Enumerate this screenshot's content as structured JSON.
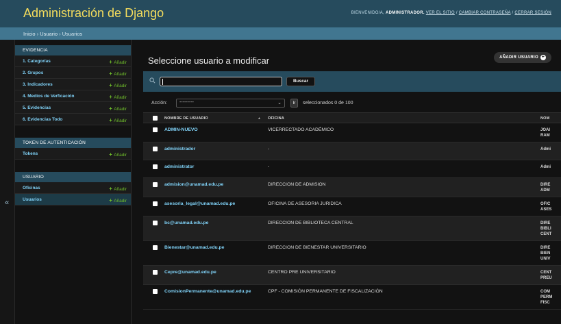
{
  "header": {
    "site_name": "Administración de Django",
    "welcome": "BIENVENIDO/A,",
    "username": "ADMINISTRADOR.",
    "view_site": "VER EL SITIO",
    "change_password": "CAMBIAR CONTRASEÑA",
    "logout": "CERRAR SESIÓN",
    "separator": " / "
  },
  "breadcrumbs": {
    "items": [
      "Inicio",
      "Usuario",
      "Usuarios"
    ],
    "separator": " › "
  },
  "nav_toggle": "«",
  "sidebar": {
    "add_label": "Añadir",
    "modules": [
      {
        "caption": "EVIDENCIA",
        "models": [
          {
            "name": "1. Categorías",
            "add": true
          },
          {
            "name": "2. Grupos",
            "add": true
          },
          {
            "name": "3. Indicadores",
            "add": true
          },
          {
            "name": "4. Medios de Verficación",
            "add": true
          },
          {
            "name": "5. Evidencias",
            "add": true
          },
          {
            "name": "6. Evidencias Todo",
            "add": true
          }
        ]
      },
      {
        "caption": "TOKEN DE AUTENTICACIÓN",
        "models": [
          {
            "name": "Tokens",
            "add": true
          }
        ]
      },
      {
        "caption": "USUARIO",
        "models": [
          {
            "name": "Oficinas",
            "add": true
          },
          {
            "name": "Usuarios",
            "add": true,
            "current": true
          }
        ]
      }
    ]
  },
  "content": {
    "title": "Seleccione usuario a modificar",
    "add_button": "AÑADIR USUARIO",
    "search_value": "",
    "search_button": "Buscar",
    "action_label": "Acción:",
    "action_selected": "---------",
    "go_button": "Ir",
    "counter": "seleccionados 0 de 100"
  },
  "table": {
    "columns": [
      "NOMBRE DE USUARIO",
      "OFICINA",
      "NOM"
    ],
    "rows": [
      {
        "username": "ADMIN-NUEVO",
        "office": "VICERRECTADO ACADÉMICO",
        "name": [
          "JOAI",
          "RAM"
        ]
      },
      {
        "username": "administrador",
        "office": "-",
        "name": [
          "Admi"
        ]
      },
      {
        "username": "administrator",
        "office": "-",
        "name": [
          "Admi"
        ]
      },
      {
        "username": "admision@unamad.edu.pe",
        "office": "DIRECCION DE ADMISION",
        "name": [
          "DIRE",
          "ADM"
        ]
      },
      {
        "username": "asesoria_legal@unamad.edu.pe",
        "office": "OFICINA DE ASESORIA JURIDICA",
        "name": [
          "OFIC",
          "ASES"
        ]
      },
      {
        "username": "bc@unamad.edu.pe",
        "office": "DIRECCION DE BIBLIOTECA CENTRAL",
        "name": [
          "DIRE",
          "BIBLI",
          "CENT"
        ]
      },
      {
        "username": "Bienestar@unamad.edu.pe",
        "office": "DIRECCION DE BIENESTAR UNIVERSITARIO",
        "name": [
          "DIRE",
          "BIEN",
          "UNIV"
        ]
      },
      {
        "username": "Cepre@unamad.edu.pe",
        "office": "CENTRO PRE UNIVERSITARIO",
        "name": [
          "CENT",
          "PREU"
        ]
      },
      {
        "username": "ComisionPermanente@unamad.edu.pe",
        "office": "CPF - COMISIÓN PERMANENTE DE FISCALIZACIÓN",
        "name": [
          "COM",
          "PERM",
          "FISC"
        ]
      }
    ]
  },
  "colors": {
    "header_bg": "#264b5d",
    "breadcrumb_bg": "#417690",
    "brand_yellow": "#f5dd5d",
    "link": "#81d4fa",
    "add_green": "#70bf2b"
  }
}
